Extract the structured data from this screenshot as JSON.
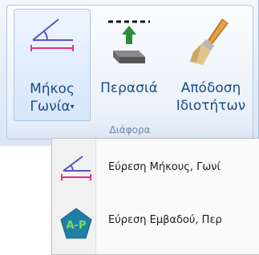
{
  "ribbon": {
    "buttons": [
      {
        "line1": "Μήκος",
        "line2": "Γωνία",
        "has_dropdown": true,
        "icon": "length-angle-icon"
      },
      {
        "line1": "Περασιά",
        "line2": "",
        "has_dropdown": false,
        "icon": "offset-icon"
      },
      {
        "line1": "Απόδοση",
        "line2": "Ιδιοτήτων",
        "has_dropdown": false,
        "icon": "paintbrush-icon"
      }
    ],
    "group_title": "Διάφορα"
  },
  "dropdown": {
    "items": [
      {
        "label": "Εύρεση Μήκους, Γωνί",
        "icon": "length-angle-icon"
      },
      {
        "label": "Εύρεση Εμβαδού, Περ",
        "icon": "area-perimeter-icon"
      }
    ]
  },
  "colors": {
    "ribbon_text": "#1d4b84",
    "pentagon": "#1e7fa6",
    "pentagon_text": "#7be05a",
    "angle_line": "#5a52c9",
    "base_line": "#e0328a"
  }
}
